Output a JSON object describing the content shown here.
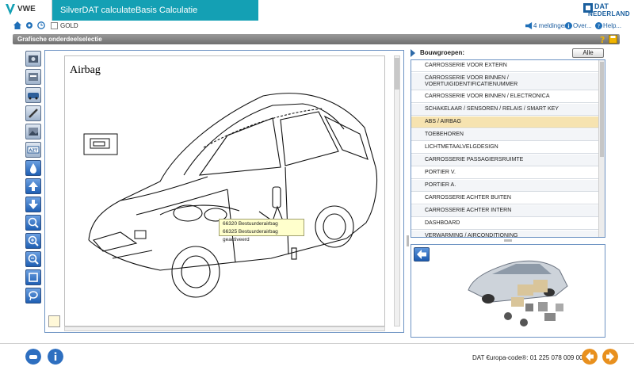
{
  "app": {
    "brand": "VWE",
    "title": "SilverDAT calculateBasis Calculatie",
    "dat_logo_line1": "DAT",
    "dat_logo_line2": "NEDERLAND"
  },
  "iconrow": {
    "gold_label": "GOLD",
    "messages": "4 meldingen",
    "about": "Over...",
    "help": "Help..."
  },
  "section": {
    "title": "Grafische onderdeelselectie"
  },
  "drawing": {
    "title": "Airbag",
    "tooltip_lines": [
      "66320 Bestuurderairbag",
      "66325 Bestuurderairbag geactiveerd"
    ]
  },
  "bouwgroepen": {
    "label": "Bouwgroepen:",
    "all_button": "Alle",
    "items": [
      "CARROSSERIE VOOR EXTERN",
      "CARROSSERIE VOOR BINNEN / VOERTUIGIDENTIFICATIENUMMER",
      "CARROSSERIE VOOR BINNEN / ELECTRONICA",
      "SCHAKELAAR / SENSOREN / RELAIS / SMART KEY",
      "ABS / AIRBAG",
      "TOEBEHOREN",
      "LICHTMETAALVELGDESIGN",
      "CARROSSERIE PASSAGIERSRUIMTE",
      "PORTIER V.",
      "PORTIER A.",
      "CARROSSERIE ACHTER BUITEN",
      "CARROSSERIE ACHTER INTERN",
      "DASHBOARD",
      "VERWARMING / AIRCONDITIONING"
    ],
    "selected_index": 4
  },
  "footer": {
    "code_text": "DAT €uropa-code®: 01 225 078 009 0001"
  },
  "colors": {
    "title_bar": "#14a0b4",
    "panel_border": "#6d93c3",
    "selected_row": "#f6e3b0",
    "nav_orange": "#e8901e"
  }
}
